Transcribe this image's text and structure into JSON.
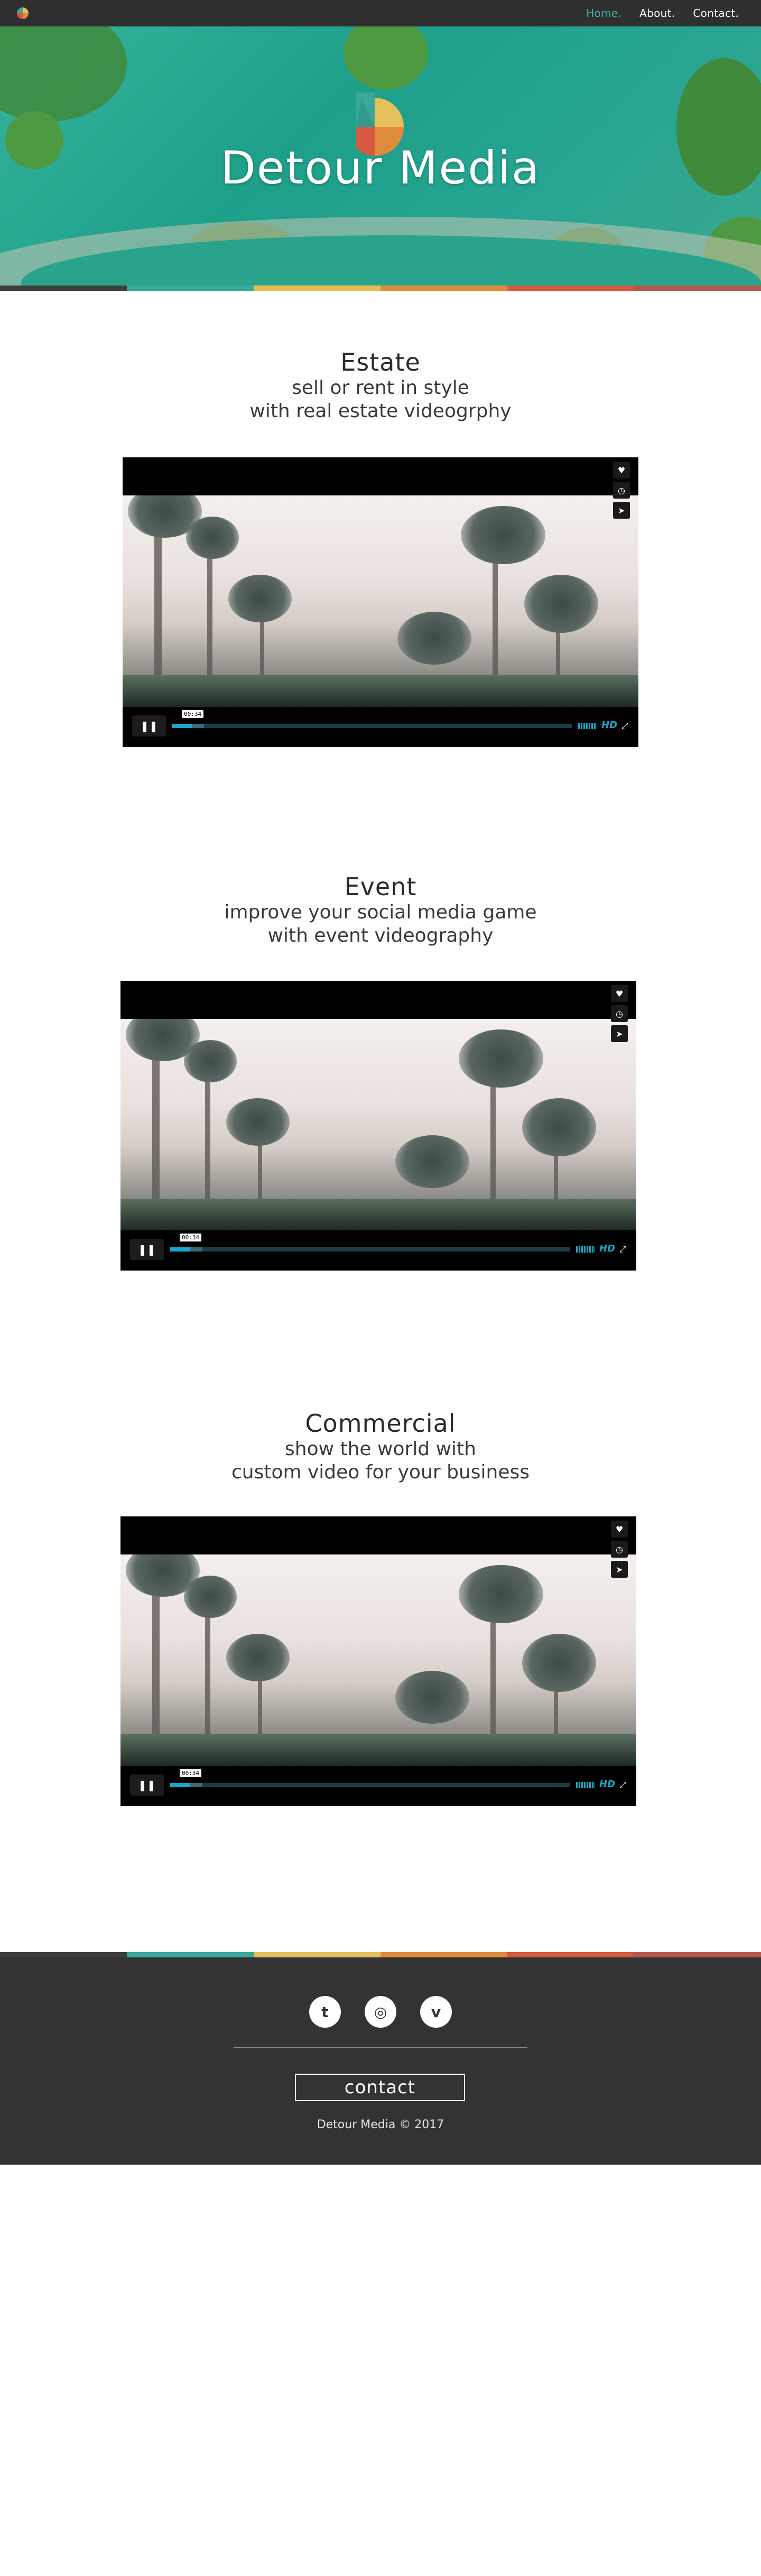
{
  "nav": {
    "items": [
      {
        "label": "Home.",
        "active": true
      },
      {
        "label": "About.",
        "active": false
      },
      {
        "label": "Contact.",
        "active": false
      }
    ]
  },
  "hero": {
    "title": "Detour Media"
  },
  "strip_colors": [
    "#3d3d3d",
    "#3aa89a",
    "#e5c05a",
    "#e08a3c",
    "#d65a3f",
    "#b5594d"
  ],
  "sections": [
    {
      "title": "Estate",
      "subtitle_line1": "sell or rent in style",
      "subtitle_line2": "with real estate videogrphy",
      "video": {
        "time": "00:34",
        "progress": 0.05,
        "quality": "HD"
      }
    },
    {
      "title": "Event",
      "subtitle_line1": "improve your social media game",
      "subtitle_line2": "with event videography",
      "video": {
        "time": "00:34",
        "progress": 0.05,
        "quality": "HD"
      }
    },
    {
      "title": "Commercial",
      "subtitle_line1": "show the world with",
      "subtitle_line2": "custom video for your business",
      "video": {
        "time": "00:34",
        "progress": 0.05,
        "quality": "HD"
      }
    }
  ],
  "player_icons": [
    "heart-icon",
    "clock-icon",
    "share-icon"
  ],
  "footer": {
    "social": [
      "twitter-icon",
      "instagram-icon",
      "vimeo-icon"
    ],
    "contact_label": "contact",
    "copyright": "Detour Media © 2017"
  }
}
